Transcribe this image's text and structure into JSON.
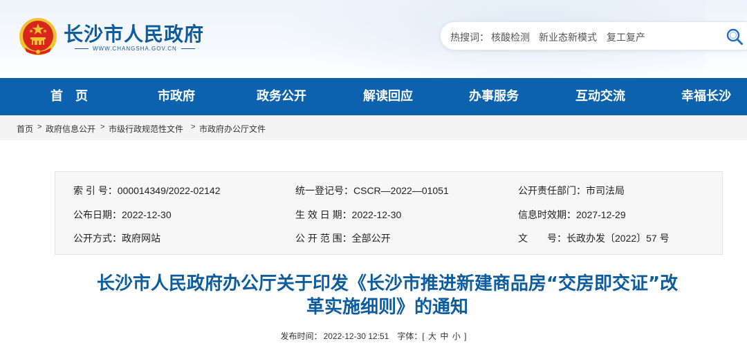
{
  "header": {
    "site_title": "长沙市人民政府",
    "site_url": "WWW.CHANGSHA.GOV.CN",
    "search": {
      "hot_label": "热搜词：",
      "hot_words": [
        "核酸检测",
        "新业态新模式",
        "复工复产"
      ]
    }
  },
  "nav": {
    "items": [
      "首　页",
      "市政府",
      "政务公开",
      "解读回应",
      "办事服务",
      "互动交流",
      "幸福长沙"
    ]
  },
  "breadcrumb": {
    "items": [
      "首页",
      "政府信息公开",
      "市级行政规范性文件",
      "市政府办公厅文件"
    ],
    "separator": ">"
  },
  "meta": {
    "index_no": "索 引 号：000014349/2022-02142",
    "unified_no": "统一登记号：CSCR—2022—01051",
    "dept": "公开责任部门：市司法局",
    "pub_date": "公布日期：2022-12-30",
    "effective_date": "生 效 日 期：2022-12-30",
    "expiry_date": "信息时效期：2027-12-29",
    "pub_method": "公开方式：政府网站",
    "pub_scope": "公 开 范 围：全部公开",
    "doc_no_label": "文　　号：",
    "doc_no": "长政办发〔2022〕57 号"
  },
  "article": {
    "title_line1": "长沙市人民政府办公厅关于印发《长沙市推进新建商品房“交房即交证”改",
    "title_line2": "革实施细则》的通知",
    "pub_time_label": "发布时间：",
    "pub_time": "2022-12-30 12:51",
    "font_label": "字体：[",
    "font_large": "大",
    "font_medium": "中",
    "font_small": "小",
    "font_close": "]"
  },
  "colors": {
    "nav_bg": "#0c62ac",
    "title_blue": "#0d5c9e",
    "emblem_red": "#d8261d",
    "emblem_gold": "#f2c230"
  }
}
